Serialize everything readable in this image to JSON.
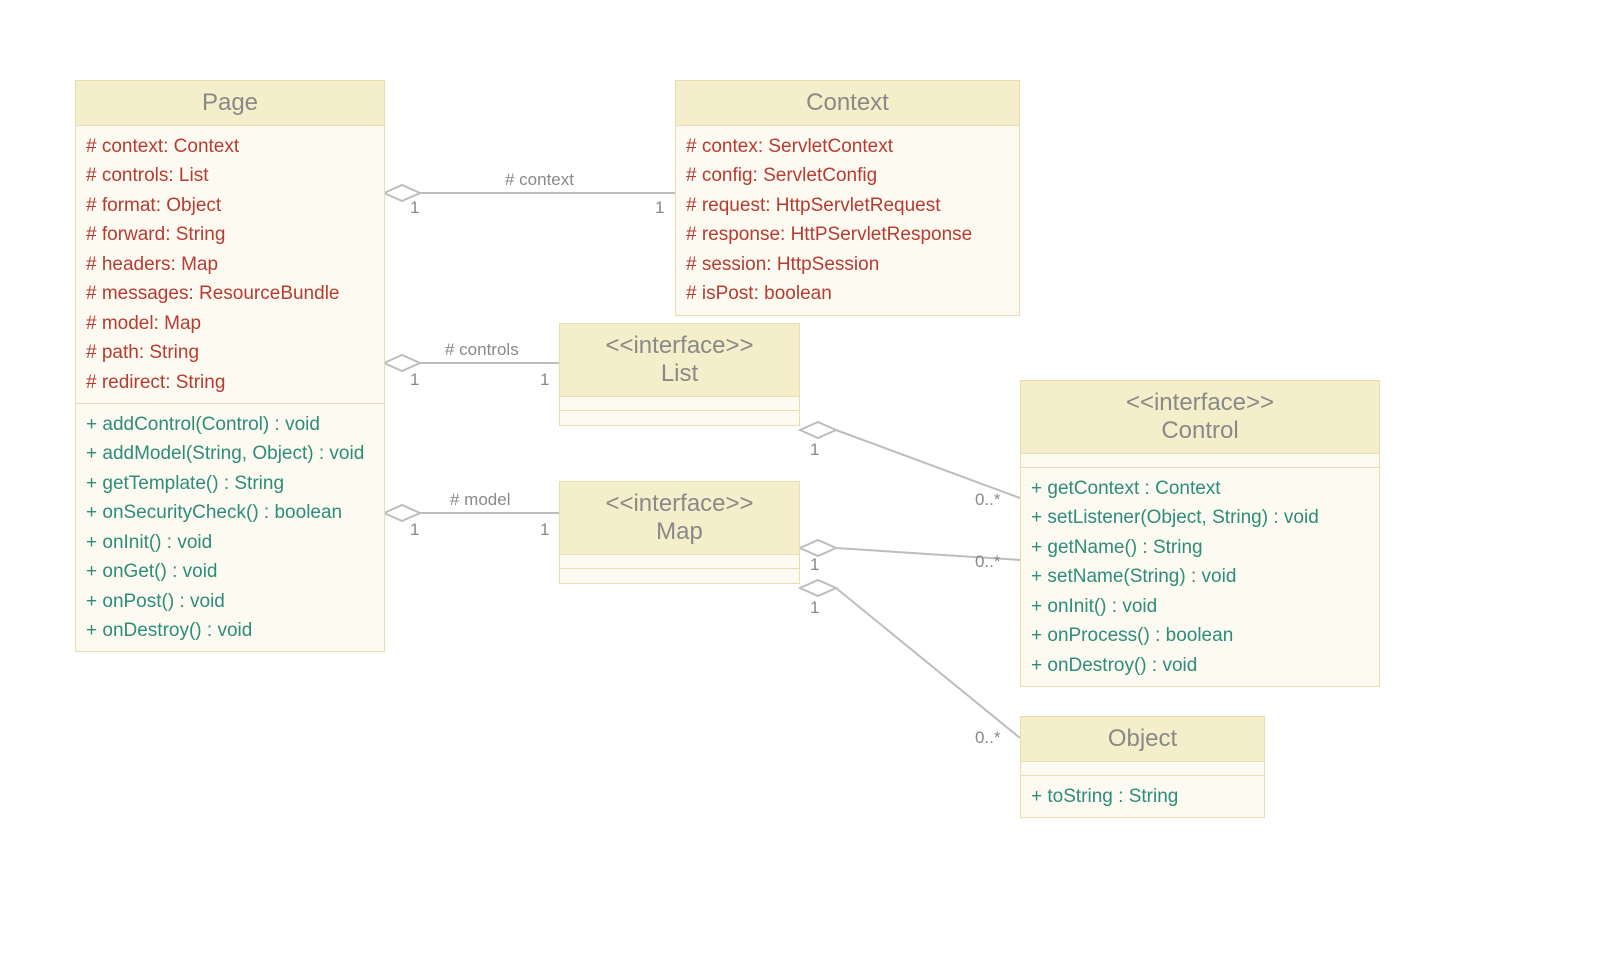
{
  "classes": {
    "page": {
      "name": "Page",
      "attributes": [
        "# context: Context",
        "# controls: List",
        "# format: Object",
        "# forward: String",
        "# headers: Map",
        "# messages: ResourceBundle",
        "# model: Map",
        "# path: String",
        "# redirect: String"
      ],
      "operations": [
        "+ addControl(Control) : void",
        "+ addModel(String, Object) : void",
        "+ getTemplate() : String",
        "+ onSecurityCheck() : boolean",
        "+ onInit() : void",
        "+ onGet() : void",
        "+ onPost() : void",
        "+ onDestroy() : void"
      ]
    },
    "context": {
      "name": "Context",
      "attributes": [
        "# contex: ServletContext",
        "# config: ServletConfig",
        "# request: HttpServletRequest",
        "# response: HttPServletResponse",
        "# session: HttpSession",
        "# isPost: boolean"
      ]
    },
    "list": {
      "stereotype": "<<interface>>",
      "name": "List"
    },
    "map": {
      "stereotype": "<<interface>>",
      "name": "Map"
    },
    "control": {
      "stereotype": "<<interface>>",
      "name": "Control",
      "operations": [
        "+ getContext : Context",
        "+ setListener(Object, String) : void",
        "+ getName() : String",
        "+ setName(String) : void",
        "+ onInit() : void",
        "+ onProcess() : boolean",
        "+ onDestroy() : void"
      ]
    },
    "object": {
      "name": "Object",
      "operations": [
        "+ toString : String"
      ]
    }
  },
  "labels": {
    "context_assoc": "# context",
    "controls_assoc": "# controls",
    "model_assoc": "# model",
    "one": "1",
    "zeroMany": "0..*"
  }
}
